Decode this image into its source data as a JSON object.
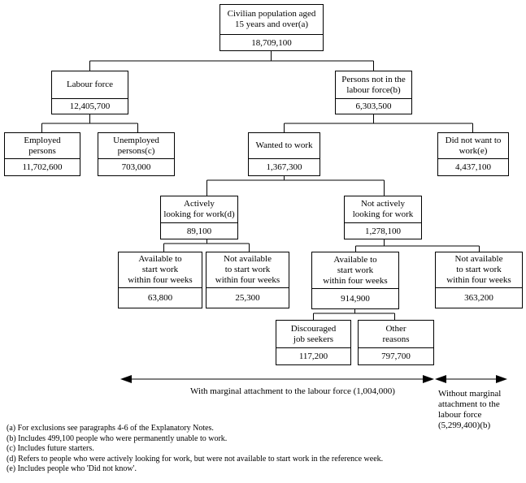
{
  "nodes": {
    "root": {
      "label": "Civilian population aged\n15 years and over(a)",
      "value": "18,709,100"
    },
    "labour_force": {
      "label": "Labour force",
      "value": "12,405,700"
    },
    "not_in_labour_force": {
      "label": "Persons not in the\nlabour force(b)",
      "value": "6,303,500"
    },
    "employed": {
      "label": "Employed\npersons",
      "value": "11,702,600"
    },
    "unemployed": {
      "label": "Unemployed\npersons(c)",
      "value": "703,000"
    },
    "wanted_to_work": {
      "label": "Wanted to work",
      "value": "1,367,300"
    },
    "did_not_want": {
      "label": "Did not want to\nwork(e)",
      "value": "4,437,100"
    },
    "actively_looking": {
      "label": "Actively\nlooking for work(d)",
      "value": "89,100"
    },
    "not_actively_looking": {
      "label": "Not actively\nlooking for work",
      "value": "1,278,100"
    },
    "active_available": {
      "label": "Available to\nstart work\nwithin four weeks",
      "value": "63,800"
    },
    "active_not_available": {
      "label": "Not available\nto start work\nwithin four weeks",
      "value": "25,300"
    },
    "notactive_available": {
      "label": "Available to\nstart work\nwithin four weeks",
      "value": "914,900"
    },
    "notactive_not_available": {
      "label": "Not available\nto start work\nwithin four weeks",
      "value": "363,200"
    },
    "discouraged": {
      "label": "Discouraged\njob seekers",
      "value": "117,200"
    },
    "other_reasons": {
      "label": "Other\nreasons",
      "value": "797,700"
    }
  },
  "annotations": {
    "with_marginal": "With marginal attachment to the labour force (1,004,000)",
    "without_marginal": "Without marginal\nattachment to the\nlabour force\n (5,299,400)(b)"
  },
  "footnotes": [
    "(a) For exclusions see paragraphs 4-6 of the Explanatory Notes.",
    "(b) Includes 499,100 people who were permanently unable to work.",
    "(c) Includes future starters.",
    "(d) Refers to people who were actively looking for work, but were not available to start work in the reference week.",
    "(e) Includes people who 'Did not know'."
  ]
}
